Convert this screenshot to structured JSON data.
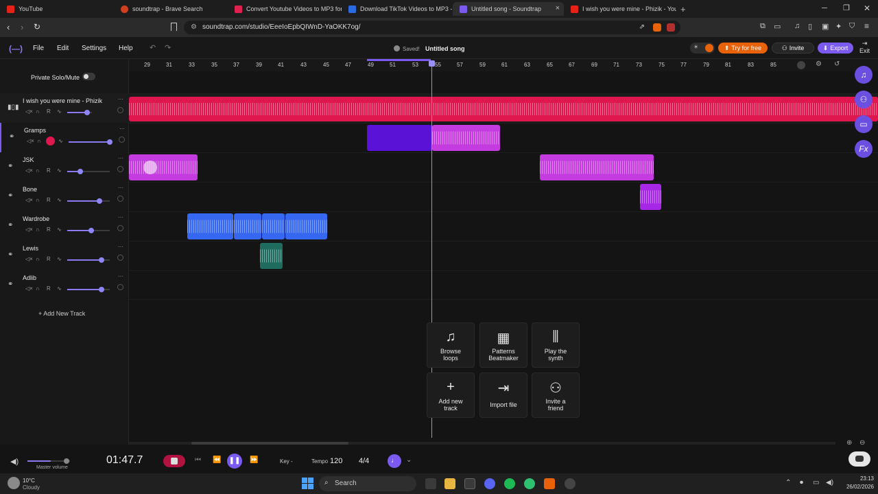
{
  "browser": {
    "tabs": [
      {
        "title": "YouTube",
        "color": "#e62117"
      },
      {
        "title": "soundtrap - Brave Search",
        "color": "#d04020"
      },
      {
        "title": "Convert Youtube Videos to MP3 for f",
        "color": "#e0204d"
      },
      {
        "title": "Download TikTok Videos to MP3 - Fr",
        "color": "#2a6be0"
      },
      {
        "title": "Untitled song - Soundtrap",
        "color": "#7b5af0"
      },
      {
        "title": "I wish you were mine - Phizik - YouTu",
        "color": "#e62117"
      }
    ],
    "url": "soundtrap.com/studio/EeeIoEpbQIWnD-YaOKK7og/"
  },
  "menu": {
    "file": "File",
    "edit": "Edit",
    "settings": "Settings",
    "help": "Help"
  },
  "status": {
    "saved": "Saved!",
    "song_title": "Untitled song"
  },
  "header_actions": {
    "try_free": "Try for free",
    "invite": "Invite",
    "export": "Export",
    "exit": "Exit"
  },
  "private_solo": "Private Solo/Mute",
  "ruler": [
    "29",
    "31",
    "33",
    "35",
    "37",
    "39",
    "41",
    "43",
    "45",
    "47",
    "49",
    "51",
    "53",
    "55",
    "57",
    "59",
    "61",
    "63",
    "65",
    "67",
    "69",
    "71",
    "73",
    "75",
    "77",
    "79",
    "81",
    "83",
    "85"
  ],
  "tracks": [
    {
      "name": "I wish you were mine - Phizik",
      "volume": 0.5
    },
    {
      "name": "Gramps",
      "volume": 0.95
    },
    {
      "name": "JSK",
      "volume": 0.3
    },
    {
      "name": "Bone",
      "volume": 0.75
    },
    {
      "name": "Wardrobe",
      "volume": 0.55
    },
    {
      "name": "Lewis",
      "volume": 0.8
    },
    {
      "name": "Adlib",
      "volume": 0.8
    }
  ],
  "track_ctl": {
    "rec": "R",
    "more": "···"
  },
  "add_track": "Add New Track",
  "cards": [
    {
      "label": "Browse loops",
      "icon": "♫"
    },
    {
      "label": "Patterns Beatmaker",
      "icon": "▦"
    },
    {
      "label": "Play the synth",
      "icon": "⫼"
    },
    {
      "label": "Add new track",
      "icon": "+"
    },
    {
      "label": "Import file",
      "icon": "⇥"
    },
    {
      "label": "Invite a friend",
      "icon": "⚇"
    }
  ],
  "transport": {
    "master_volume_label": "Master volume",
    "master_volume": 0.55,
    "time": "01:47.7",
    "key_label": "Key",
    "key_value": "-",
    "tempo_label": "Tempo",
    "tempo_value": "120",
    "time_sig": "4/4"
  },
  "taskbar": {
    "weather_temp": "10°C",
    "weather_desc": "Cloudy",
    "search": "Search",
    "time": "23:13",
    "date": "26/02/2026"
  },
  "colors": {
    "accent": "#7b5af0",
    "red_clip": "#e0174f",
    "purple_clip": "#5a12d6",
    "pink_clip": "#c43ce0",
    "blue_clip": "#3567f0",
    "teal_clip": "#1f6c5f",
    "violet_clip": "#a627e6",
    "orange": "#e8620a"
  }
}
